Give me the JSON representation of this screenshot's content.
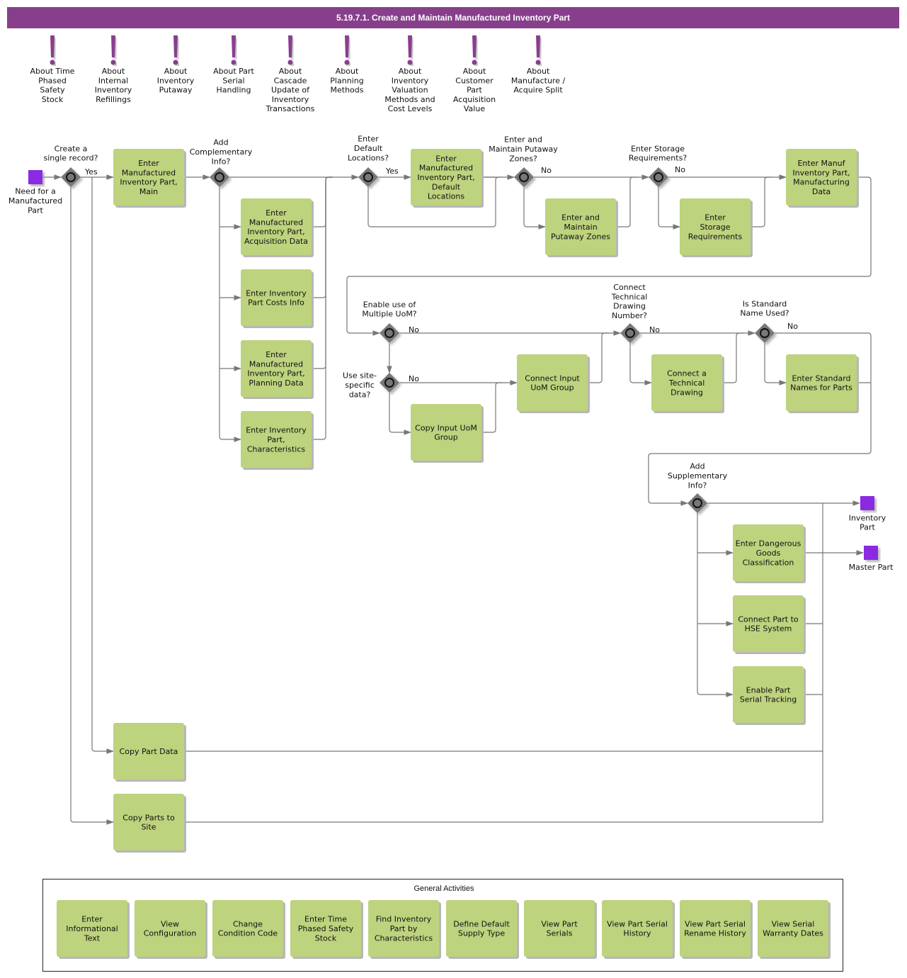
{
  "title": "5.19.7.1. Create and Maintain Manufactured Inventory Part",
  "colors": {
    "title_bar": "#873f8c",
    "annotation_icon": "#8a3e90",
    "task_fill": "#bed37e",
    "event_fill": "#8a2be2",
    "gateway_fill": "#777777",
    "connector": "#777777"
  },
  "annotations": [
    {
      "id": "a1",
      "label": "About Time\nPhased\nSafety\nStock"
    },
    {
      "id": "a2",
      "label": "About\nInternal\nInventory\nRefillings"
    },
    {
      "id": "a3",
      "label": "About\nInventory\nPutaway"
    },
    {
      "id": "a4",
      "label": "About Part\nSerial\nHandling"
    },
    {
      "id": "a5",
      "label": "About\nCascade\nUpdate of\nInventory\nTransactions"
    },
    {
      "id": "a6",
      "label": "About\nPlanning\nMethods"
    },
    {
      "id": "a7",
      "label": "About\nInventory\nValuation\nMethods and\nCost Levels"
    },
    {
      "id": "a8",
      "label": "About\nCustomer\nPart\nAcquisition\nValue"
    },
    {
      "id": "a9",
      "label": "About\nManufacture /\nAcquire Split"
    }
  ],
  "events": {
    "start": {
      "label": "Need for a\nManufactured\nPart"
    },
    "end_inventory": {
      "label": "Inventory\nPart"
    },
    "end_master": {
      "label": "Master Part"
    }
  },
  "gateways": {
    "g_single": {
      "question": "Create a\nsingle record?",
      "branch": "Yes"
    },
    "g_complementary": {
      "question": "Add\nComplementary\nInfo?",
      "branch": ""
    },
    "g_default_loc": {
      "question": "Enter\nDefault\nLocations?",
      "branch": "Yes"
    },
    "g_putaway": {
      "question": "Enter and\nMaintain Putaway\nZones?",
      "branch": "No"
    },
    "g_storage": {
      "question": "Enter Storage\nRequirements?",
      "branch": "No"
    },
    "g_uom": {
      "question": "Enable use of\nMultiple UoM?",
      "branch": "No"
    },
    "g_site": {
      "question": "Use site-\nspecific\ndata?",
      "branch": "No"
    },
    "g_drawing": {
      "question": "Connect\nTechnical\nDrawing\nNumber?",
      "branch": "No"
    },
    "g_stdname": {
      "question": "Is Standard\nName Used?",
      "branch": "No"
    },
    "g_supp": {
      "question": "Add\nSupplementary\nInfo?",
      "branch": ""
    }
  },
  "tasks": {
    "t_main": "Enter\nManufactured\nInventory Part,\nMain",
    "t_acq": "Enter\nManufactured\nInventory Part,\nAcquisition Data",
    "t_costs": "Enter Inventory\nPart Costs Info",
    "t_planning": "Enter\nManufactured\nInventory Part,\nPlanning Data",
    "t_char": "Enter Inventory\nPart,\nCharacteristics",
    "t_defloc": "Enter\nManufactured\nInventory Part,\nDefault\nLocations",
    "t_putaway": "Enter and\nMaintain\nPutaway Zones",
    "t_storage": "Enter\nStorage\nRequirements",
    "t_manuf": "Enter Manuf\nInventory Part,\nManufacturing\nData",
    "t_connuom": "Connect Input\nUoM Group",
    "t_copyuom": "Copy Input UoM\nGroup",
    "t_drawing": "Connect a\nTechnical\nDrawing",
    "t_stdname": "Enter Standard\nNames for Parts",
    "t_dangerous": "Enter Dangerous\nGoods\nClassification",
    "t_hse": "Connect Part to\nHSE System",
    "t_serial": "Enable Part\nSerial Tracking",
    "t_copydata": "Copy Part Data",
    "t_copysite": "Copy Parts to\nSite"
  },
  "general_activities": {
    "title": "General Activities",
    "items": [
      "Enter\nInformational\nText",
      "View\nConfiguration",
      "Change\nCondition Code",
      "Enter Time\nPhased Safety\nStock",
      "Find Inventory\nPart by\nCharacteristics",
      "Define Default\nSupply Type",
      "View Part\nSerials",
      "View Part Serial\nHistory",
      "View Part Serial\nRename History",
      "View Serial\nWarranty Dates"
    ]
  }
}
